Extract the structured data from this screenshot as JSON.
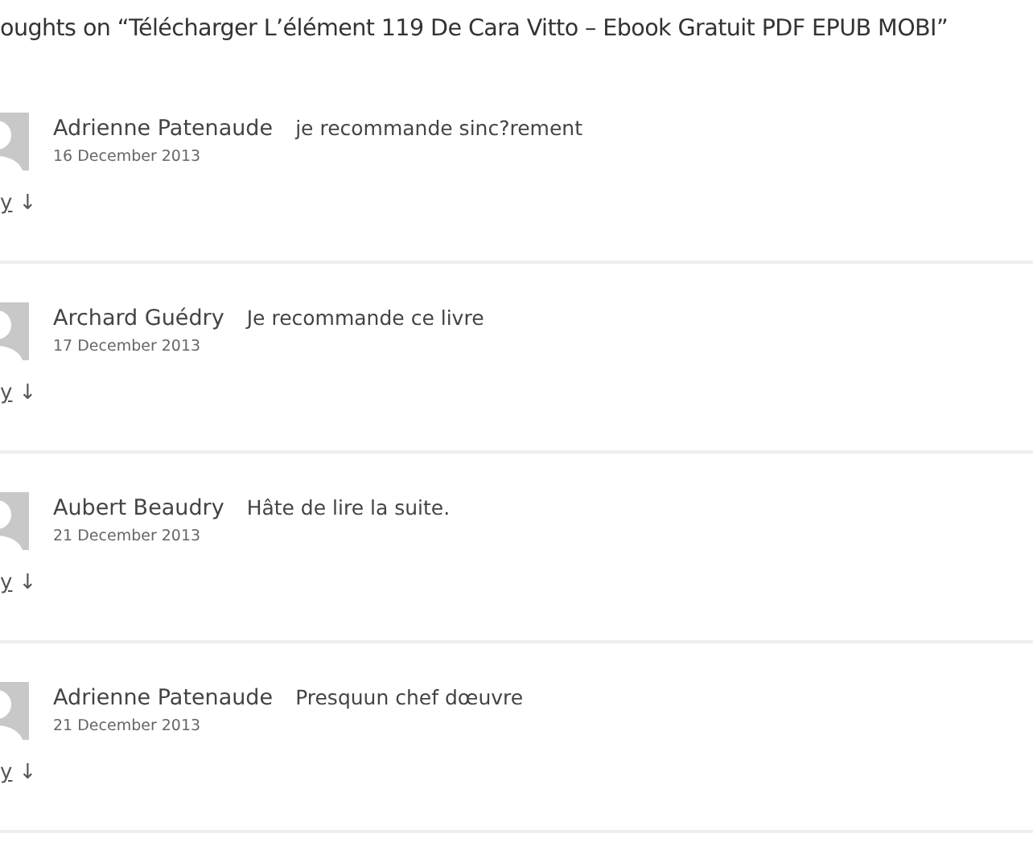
{
  "title": "oughts on “Télécharger L’élément 119 De Cara Vitto – Ebook Gratuit PDF EPUB MOBI”",
  "comments": [
    {
      "author": "Adrienne Patenaude",
      "text": "je recommande sinc?rement",
      "date": "16 December 2013",
      "reply": "y",
      "arrow": "↓"
    },
    {
      "author": "Archard Guédry",
      "text": "Je recommande ce livre",
      "date": "17 December 2013",
      "reply": "y",
      "arrow": "↓"
    },
    {
      "author": "Aubert Beaudry",
      "text": "Hâte de lire la suite.",
      "date": "21 December 2013",
      "reply": "y",
      "arrow": "↓"
    },
    {
      "author": "Adrienne Patenaude",
      "text": "Presquun chef dœuvre",
      "date": "21 December 2013",
      "reply": "y",
      "arrow": "↓"
    }
  ]
}
